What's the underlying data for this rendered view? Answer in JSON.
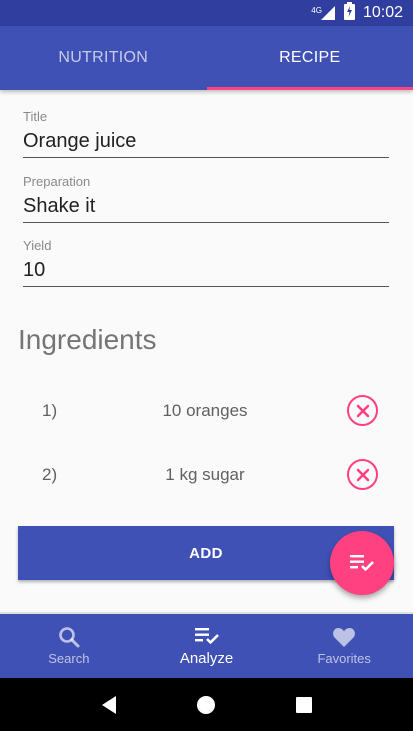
{
  "status_bar": {
    "network": "4G",
    "time": "10:02"
  },
  "tabs": [
    {
      "label": "NUTRITION",
      "active": false
    },
    {
      "label": "RECIPE",
      "active": true
    }
  ],
  "form": {
    "title": {
      "label": "Title",
      "value": "Orange juice"
    },
    "preparation": {
      "label": "Preparation",
      "value": "Shake it"
    },
    "yield": {
      "label": "Yield",
      "value": "10"
    }
  },
  "ingredients": {
    "heading": "Ingredients",
    "items": [
      {
        "number": "1)",
        "text": "10 oranges",
        "remove_icon": "close-circle-icon"
      },
      {
        "number": "2)",
        "text": "1 kg sugar",
        "remove_icon": "close-circle-icon"
      }
    ]
  },
  "add_button": {
    "label": "ADD"
  },
  "fab": {
    "icon": "playlist-check-icon"
  },
  "bottom_nav": [
    {
      "label": "Search",
      "icon": "search-icon",
      "active": false
    },
    {
      "label": "Analyze",
      "icon": "playlist-check-icon",
      "active": true
    },
    {
      "label": "Favorites",
      "icon": "heart-icon",
      "active": false
    }
  ],
  "colors": {
    "primary": "#3f51b5",
    "primary_dark": "#303f9f",
    "accent": "#ff4081"
  }
}
